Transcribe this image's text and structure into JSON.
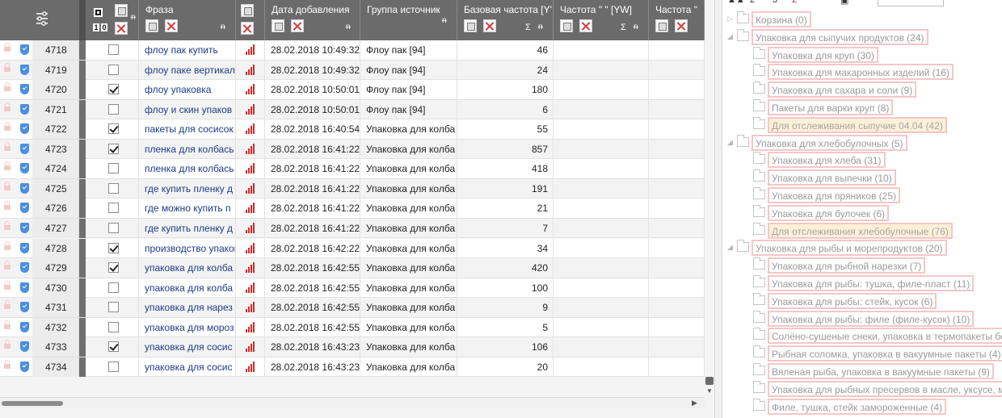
{
  "grid": {
    "header": {
      "checkbox_labels": [
        "1",
        "0"
      ],
      "phrase": "Фраза",
      "date_added": "Дата добавления",
      "source_group": "Группа источник",
      "base_freq": "Базовая частота [Y'",
      "freq_yw": "Частота \" \" [YW]",
      "freq_more": "Частота \"",
      "sigma": "Σ",
      "pin": "ᵰ"
    },
    "rows": [
      {
        "id": "4718",
        "checked": false,
        "phrase": "флоу пак купить",
        "date": "28.02.2018 10:49:32",
        "group": "Флоу пак [94]",
        "base": "46"
      },
      {
        "id": "4719",
        "checked": false,
        "phrase": "флоу паке вертикал",
        "date": "28.02.2018 10:49:32",
        "group": "Флоу пак [94]",
        "base": "24"
      },
      {
        "id": "4720",
        "checked": true,
        "phrase": "флоу упаковка",
        "date": "28.02.2018 10:50:01",
        "group": "Флоу пак [94]",
        "base": "180"
      },
      {
        "id": "4721",
        "checked": false,
        "phrase": "флоу и скин упаков",
        "date": "28.02.2018 10:50:01",
        "group": "Флоу пак [94]",
        "base": "6"
      },
      {
        "id": "4722",
        "checked": true,
        "phrase": "пакеты для сосисок",
        "date": "28.02.2018 16:40:54",
        "group": "Упаковка для колба",
        "base": "55"
      },
      {
        "id": "4723",
        "checked": true,
        "phrase": "пленка для колбась",
        "date": "28.02.2018 16:41:22",
        "group": "Упаковка для колба",
        "base": "857"
      },
      {
        "id": "4724",
        "checked": false,
        "phrase": "пленка для колбась",
        "date": "28.02.2018 16:41:22",
        "group": "Упаковка для колба",
        "base": "418"
      },
      {
        "id": "4725",
        "checked": false,
        "phrase": "где купить пленку д",
        "date": "28.02.2018 16:41:22",
        "group": "Упаковка для колба",
        "base": "191"
      },
      {
        "id": "4726",
        "checked": false,
        "phrase": "где можно купить п",
        "date": "28.02.2018 16:41:22",
        "group": "Упаковка для колба",
        "base": "21"
      },
      {
        "id": "4727",
        "checked": false,
        "phrase": "где купить пленку д",
        "date": "28.02.2018 16:41:22",
        "group": "Упаковка для колба",
        "base": "7"
      },
      {
        "id": "4728",
        "checked": true,
        "phrase": "производство упаков",
        "date": "28.02.2018 16:42:22",
        "group": "Упаковка для колба",
        "base": "34"
      },
      {
        "id": "4729",
        "checked": true,
        "phrase": "упаковка для колба",
        "date": "28.02.2018 16:42:55",
        "group": "Упаковка для колба",
        "base": "420"
      },
      {
        "id": "4730",
        "checked": false,
        "phrase": "упаковка для колба",
        "date": "28.02.2018 16:42:55",
        "group": "Упаковка для колба",
        "base": "100"
      },
      {
        "id": "4731",
        "checked": false,
        "phrase": "упаковка для нарез",
        "date": "28.02.2018 16:42:55",
        "group": "Упаковка для колба",
        "base": "9"
      },
      {
        "id": "4732",
        "checked": false,
        "phrase": "упаковка для мороз",
        "date": "28.02.2018 16:42:55",
        "group": "Упаковка для колба",
        "base": "5"
      },
      {
        "id": "4733",
        "checked": true,
        "phrase": "упаковка для сосис",
        "date": "28.02.2018 16:43:23",
        "group": "Упаковка для колба",
        "base": "106"
      },
      {
        "id": "4734",
        "checked": false,
        "phrase": "упаковка для сосис",
        "date": "28.02.2018 16:43:23",
        "group": "Упаковка для колба",
        "base": "20"
      }
    ]
  },
  "tree": {
    "toolbar": [
      "2",
      "3",
      "2"
    ],
    "nodes": [
      {
        "level": 0,
        "label": "Корзина (0)",
        "orange": false
      },
      {
        "level": 0,
        "label": "Упаковка для сыпучих продуктов (24)",
        "orange": false
      },
      {
        "level": 1,
        "label": "Упаковка для круп (30)",
        "orange": false
      },
      {
        "level": 1,
        "label": "Упаковка для макаронных изделий (16)",
        "orange": false
      },
      {
        "level": 1,
        "label": "Упаковка для сахара и соли (9)",
        "orange": false
      },
      {
        "level": 1,
        "label": "Пакеты для варки круп (8)",
        "orange": false
      },
      {
        "level": 1,
        "label": "Для отслеживания сыпучие 04.04 (42)",
        "orange": true
      },
      {
        "level": 0,
        "label": "Упаковка для хлебобулочных (5)",
        "orange": false
      },
      {
        "level": 1,
        "label": "Упаковка для хлеба (31)",
        "orange": false
      },
      {
        "level": 1,
        "label": "Упаковка для выпечки (10)",
        "orange": false
      },
      {
        "level": 1,
        "label": "Упаковка для пряников (25)",
        "orange": false
      },
      {
        "level": 1,
        "label": "Упаковка для булочек (6)",
        "orange": false
      },
      {
        "level": 1,
        "label": "Для отслеживания хлебобулочные (76)",
        "orange": true
      },
      {
        "level": 0,
        "label": "Упаковка для рыбы и морепродуктов (20)",
        "orange": false
      },
      {
        "level": 1,
        "label": "Упаковка для рыбной нарезки (7)",
        "orange": false
      },
      {
        "level": 1,
        "label": "Упаковка для рыбы: тушка, филе-пласт (11)",
        "orange": false
      },
      {
        "level": 1,
        "label": "Упаковка для рыбы: стейк, кусок (6)",
        "orange": false
      },
      {
        "level": 1,
        "label": "Упаковка для рыбы: филе (филе-кусок) (10)",
        "orange": false
      },
      {
        "level": 1,
        "label": "Солёно-сушеные снеки, упаковка в термопакеты бе",
        "orange": false
      },
      {
        "level": 1,
        "label": "Рыбная соломка, упаковка в вакуумные пакеты (4)",
        "orange": false
      },
      {
        "level": 1,
        "label": "Вяленая рыба, упаковка в вакуумные пакеты (9)",
        "orange": false
      },
      {
        "level": 1,
        "label": "Упаковка для рыбных пресервов в масле, уксусе, ма",
        "orange": false
      },
      {
        "level": 1,
        "label": "Филе, тушка, стейк замороженные (4)",
        "orange": false
      }
    ]
  }
}
